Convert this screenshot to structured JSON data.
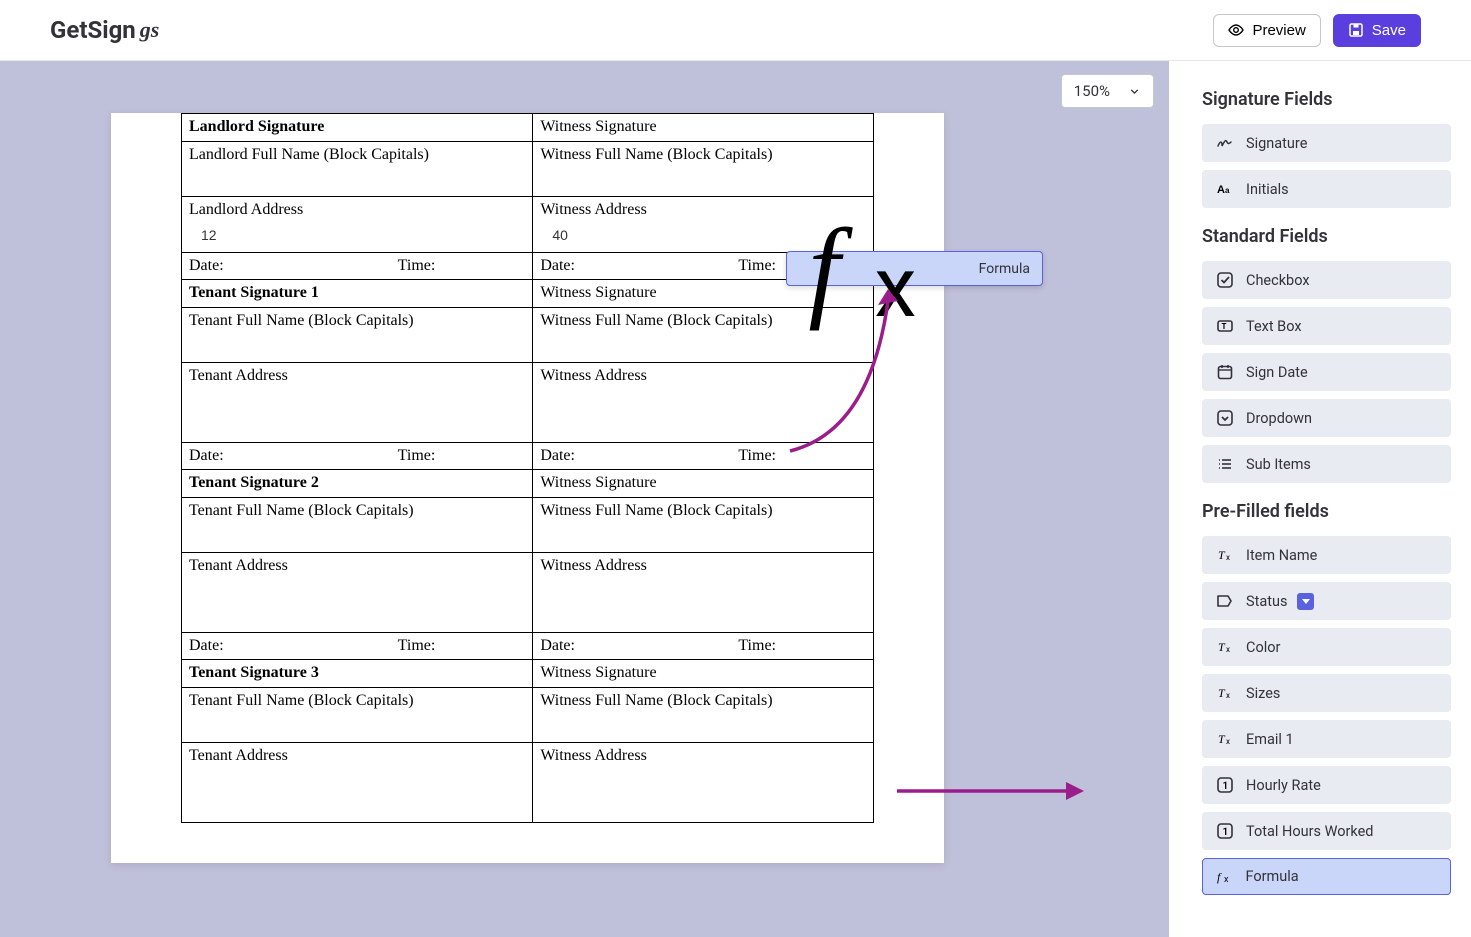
{
  "app": {
    "logo_main": "GetSign",
    "logo_script": "gs",
    "preview_label": "Preview",
    "save_label": "Save"
  },
  "zoom": {
    "value": "150%"
  },
  "document": {
    "rows": [
      {
        "left": {
          "label": "Landlord Signature",
          "bold": true
        },
        "right": {
          "label": "Witness Signature"
        }
      },
      {
        "left": {
          "label": "Landlord Full Name (Block  Capitals)"
        },
        "right": {
          "label": "Witness Full Name (Block  Capitals)"
        },
        "type": "name"
      },
      {
        "left": {
          "label": "Landlord Address",
          "value": "12"
        },
        "right": {
          "label": "Witness Address",
          "value": "40"
        },
        "type": "addr-short"
      },
      {
        "left": {
          "date": "Date:",
          "time": "Time:"
        },
        "right": {
          "date": "Date:",
          "time": "Time:"
        },
        "type": "dt"
      },
      {
        "left": {
          "label": "Tenant Signature 1",
          "bold": true
        },
        "right": {
          "label": "Witness Signature"
        }
      },
      {
        "left": {
          "label": "Tenant Full Name (Block  Capitals)"
        },
        "right": {
          "label": "Witness Full Name (Block  Capitals)"
        },
        "type": "name"
      },
      {
        "left": {
          "label": "Tenant Address"
        },
        "right": {
          "label": "Witness Address"
        },
        "type": "addr"
      },
      {
        "left": {
          "date": "Date:",
          "time": "Time:"
        },
        "right": {
          "date": "Date:",
          "time": "Time:"
        },
        "type": "dt"
      },
      {
        "left": {
          "label": "Tenant Signature 2",
          "bold": true
        },
        "right": {
          "label": "Witness Signature"
        }
      },
      {
        "left": {
          "label": "Tenant Full Name (Block  Capitals)"
        },
        "right": {
          "label": "Witness Full Name (Block  Capitals)"
        },
        "type": "name"
      },
      {
        "left": {
          "label": "Tenant Address"
        },
        "right": {
          "label": "Witness Address"
        },
        "type": "addr"
      },
      {
        "left": {
          "date": "Date:",
          "time": "Time:"
        },
        "right": {
          "date": "Date:",
          "time": "Time:"
        },
        "type": "dt"
      },
      {
        "left": {
          "label": "Tenant Signature 3",
          "bold": true
        },
        "right": {
          "label": "Witness Signature"
        }
      },
      {
        "left": {
          "label": "Tenant Full Name (Block  Capitals)"
        },
        "right": {
          "label": "Witness Full Name (Block  Capitals)"
        },
        "type": "name"
      },
      {
        "left": {
          "label": "Tenant Address"
        },
        "right": {
          "label": "Witness Address"
        },
        "type": "addr"
      }
    ]
  },
  "dragged": {
    "label": "Formula"
  },
  "sidebar": {
    "sections": [
      {
        "title": "Signature Fields",
        "items": [
          {
            "label": "Signature",
            "icon": "signature"
          },
          {
            "label": "Initials",
            "icon": "initials"
          }
        ]
      },
      {
        "title": "Standard Fields",
        "items": [
          {
            "label": "Checkbox",
            "icon": "checkbox"
          },
          {
            "label": "Text Box",
            "icon": "textbox"
          },
          {
            "label": "Sign Date",
            "icon": "date"
          },
          {
            "label": "Dropdown",
            "icon": "dropdown"
          },
          {
            "label": "Sub Items",
            "icon": "list"
          }
        ]
      },
      {
        "title": "Pre-Filled fields",
        "items": [
          {
            "label": "Item Name",
            "icon": "tx"
          },
          {
            "label": "Status",
            "icon": "status"
          },
          {
            "label": "Color",
            "icon": "tx"
          },
          {
            "label": "Sizes",
            "icon": "tx"
          },
          {
            "label": "Email 1",
            "icon": "tx"
          },
          {
            "label": "Hourly Rate",
            "icon": "num"
          },
          {
            "label": "Total Hours Worked",
            "icon": "num"
          },
          {
            "label": "Formula",
            "icon": "fx",
            "active": true
          }
        ]
      }
    ]
  }
}
